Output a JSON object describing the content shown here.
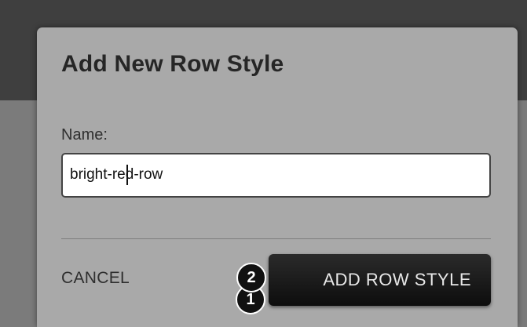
{
  "dialog": {
    "title": "Add New Row Style",
    "name_label": "Name:",
    "name_value_before_caret": "bright-",
    "name_value_after_caret": "red-row",
    "cancel_label": "CANCEL",
    "add_label": "ADD ROW STYLE"
  },
  "annotations": {
    "step1": "1",
    "step2": "2"
  }
}
